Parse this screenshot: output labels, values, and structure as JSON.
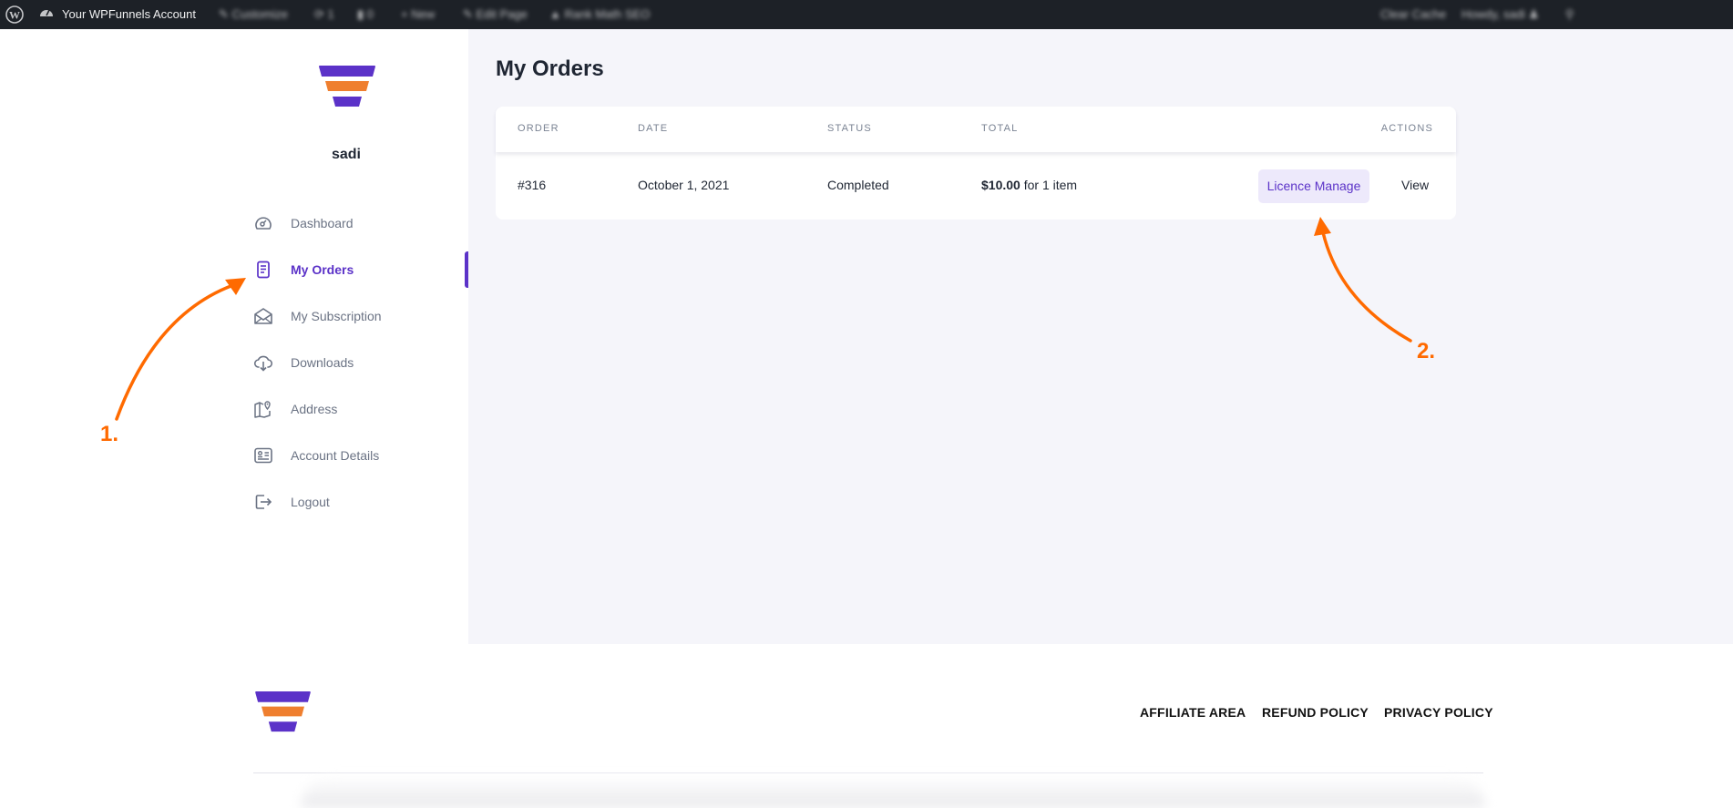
{
  "admin_bar": {
    "site_name": "Your WPFunnels Account",
    "items": [
      "Customize",
      "1",
      "0",
      "New",
      "Edit Page",
      "Rank Math SEO"
    ],
    "right_items": [
      "Clear Cache",
      "Howdy, sadi"
    ]
  },
  "sidebar": {
    "username": "sadi",
    "items": [
      {
        "label": "Dashboard",
        "icon": "dashboard-icon"
      },
      {
        "label": "My Orders",
        "icon": "orders-icon",
        "active": true
      },
      {
        "label": "My Subscription",
        "icon": "envelope-icon"
      },
      {
        "label": "Downloads",
        "icon": "cloud-download-icon"
      },
      {
        "label": "Address",
        "icon": "map-pin-icon"
      },
      {
        "label": "Account Details",
        "icon": "id-card-icon"
      },
      {
        "label": "Logout",
        "icon": "logout-icon"
      }
    ]
  },
  "main": {
    "title": "My Orders",
    "table": {
      "columns": [
        "ORDER",
        "DATE",
        "STATUS",
        "TOTAL",
        "ACTIONS"
      ],
      "rows": [
        {
          "order": "#316",
          "date": "October 1, 2021",
          "status": "Completed",
          "total_amount": "$10.00",
          "total_suffix": " for 1 item",
          "actions": [
            "Licence Manage",
            "View"
          ]
        }
      ]
    }
  },
  "annotations": [
    "1.",
    "2."
  ],
  "footer": {
    "links": [
      "AFFILIATE AREA",
      "REFUND POLICY",
      "PRIVACY POLICY"
    ]
  },
  "colors": {
    "brand_purple": "#5b32c8",
    "brand_orange": "#ef7f2f",
    "annotation_orange": "#ff6a00",
    "panel_bg": "#f5f5fa"
  }
}
